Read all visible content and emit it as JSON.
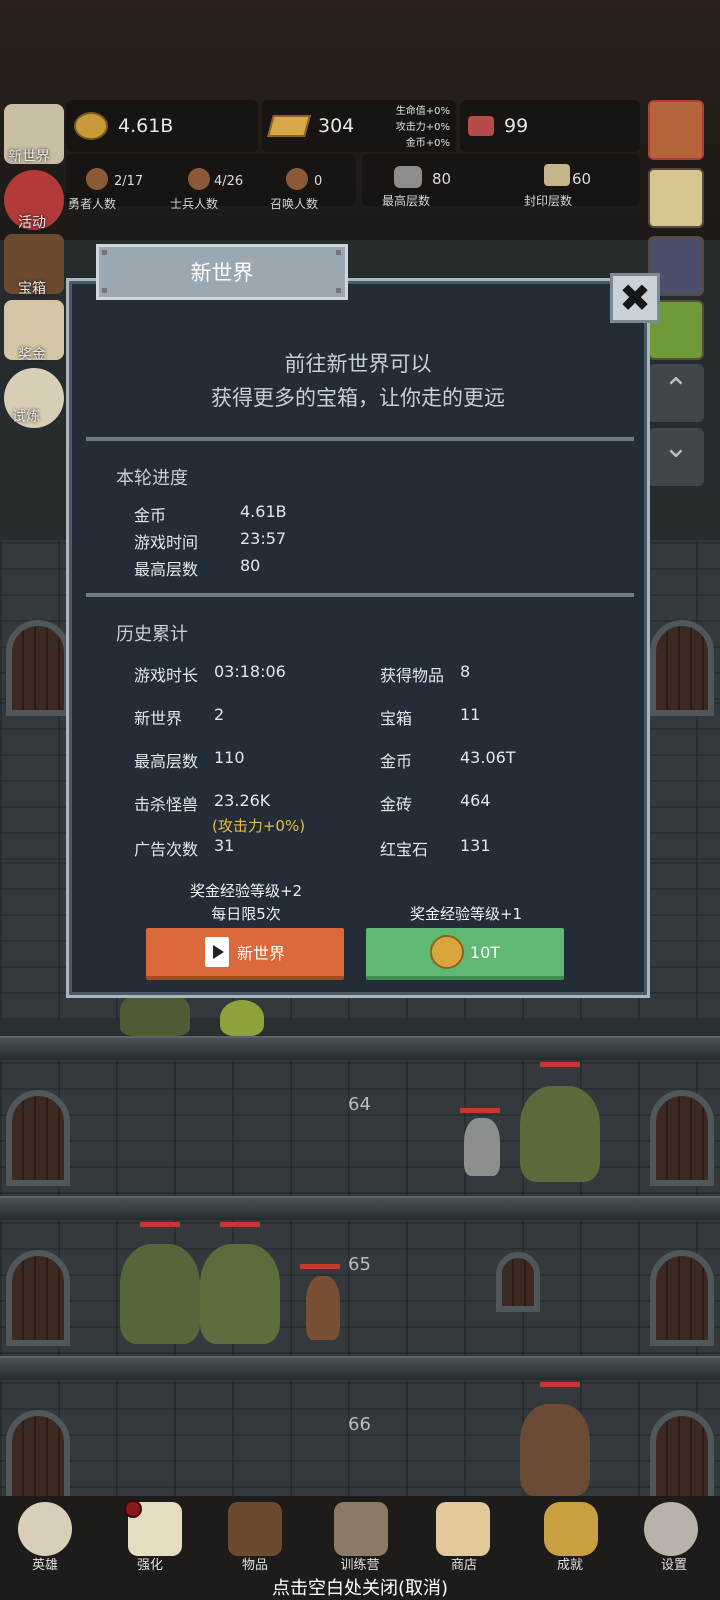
{
  "resources": {
    "gold": "4.61B",
    "gold_bar": "304",
    "ruby": "99",
    "bonus_lines": [
      "生命值+0%",
      "攻击力+0%",
      "金币+0%"
    ]
  },
  "counts": [
    {
      "value": "2/17",
      "label": "勇者人数"
    },
    {
      "value": "4/26",
      "label": "士兵人数"
    },
    {
      "value": "0",
      "label": "召唤人数"
    },
    {
      "value": "80",
      "label": "最高层数"
    },
    {
      "value": "60",
      "label": "封印层数"
    }
  ],
  "left_menu": [
    "新世界",
    "活动",
    "宝箱",
    "奖金",
    "试炼"
  ],
  "floor_numbers": [
    "64",
    "65",
    "66"
  ],
  "modal": {
    "title": "新世界",
    "close_glyph": "✖",
    "description": [
      "前往新世界可以",
      "获得更多的宝箱，让你走的更远"
    ],
    "current_title": "本轮进度",
    "current": [
      {
        "k": "金币",
        "v": "4.61B"
      },
      {
        "k": "游戏时间",
        "v": "23:57"
      },
      {
        "k": "最高层数",
        "v": "80"
      }
    ],
    "history_title": "历史累计",
    "history_left": [
      {
        "k": "游戏时长",
        "v": "03:18:06"
      },
      {
        "k": "新世界",
        "v": "2"
      },
      {
        "k": "最高层数",
        "v": "110"
      },
      {
        "k": "击杀怪兽",
        "v": "23.26K"
      },
      {
        "k": "广告次数",
        "v": "31"
      }
    ],
    "kill_note": "(攻击力+0%)",
    "history_right": [
      {
        "k": "获得物品",
        "v": "8"
      },
      {
        "k": "宝箱",
        "v": "11"
      },
      {
        "k": "金币",
        "v": "43.06T"
      },
      {
        "k": "金砖",
        "v": "464"
      },
      {
        "k": "红宝石",
        "v": "131"
      }
    ],
    "left_caption": [
      "奖金经验等级+2",
      "每日限5次"
    ],
    "right_caption": "奖金经验等级+1",
    "left_button": "新世界",
    "right_button": "10T"
  },
  "nav": [
    "英雄",
    "强化",
    "物品",
    "训练营",
    "商店",
    "成就",
    "设置"
  ],
  "footer": "点击空白处关闭(取消)",
  "colors": {
    "orange_button": "#d9683a",
    "green_button": "#5fb874",
    "note": "#e9b84b"
  }
}
